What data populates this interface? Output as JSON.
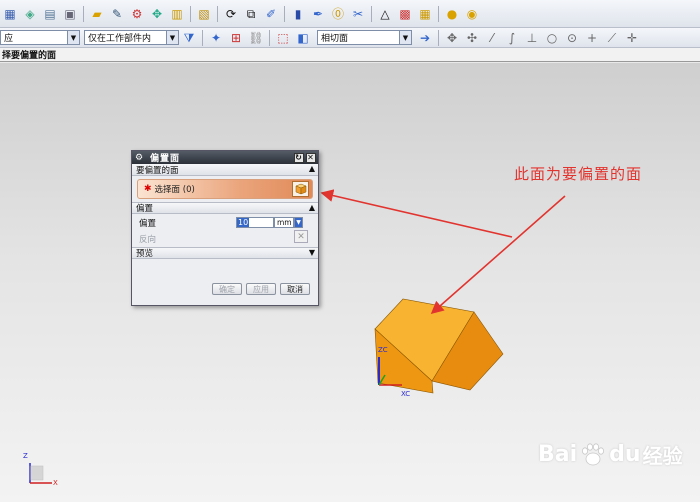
{
  "toolbar_row2": {
    "combo_left": "应",
    "combo_scope": "仅在工作部件内",
    "combo_face_rule": "相切面"
  },
  "prompt": {
    "text": "择要偏置的面"
  },
  "dialog": {
    "title": "偏置面",
    "section_faces": "要偏置的面",
    "select_face_label": "选择面 (0)",
    "section_offset": "偏置",
    "offset_label": "偏置",
    "offset_value": "10",
    "offset_unit": "mm",
    "reverse_label": "反向",
    "section_preview": "预览",
    "ok_label": "确定",
    "apply_label": "应用",
    "cancel_label": "取消"
  },
  "annotation": {
    "text": "此面为要偏置的面",
    "color": "#e2342f"
  },
  "model": {
    "face_color": "#f5a21a",
    "axis_zc": "ZC",
    "axis_xc": "XC"
  },
  "triad": {
    "z": "Z",
    "x": "X"
  },
  "watermark": {
    "brand": "Bai",
    "brand2": "du",
    "suffix": "经验"
  }
}
